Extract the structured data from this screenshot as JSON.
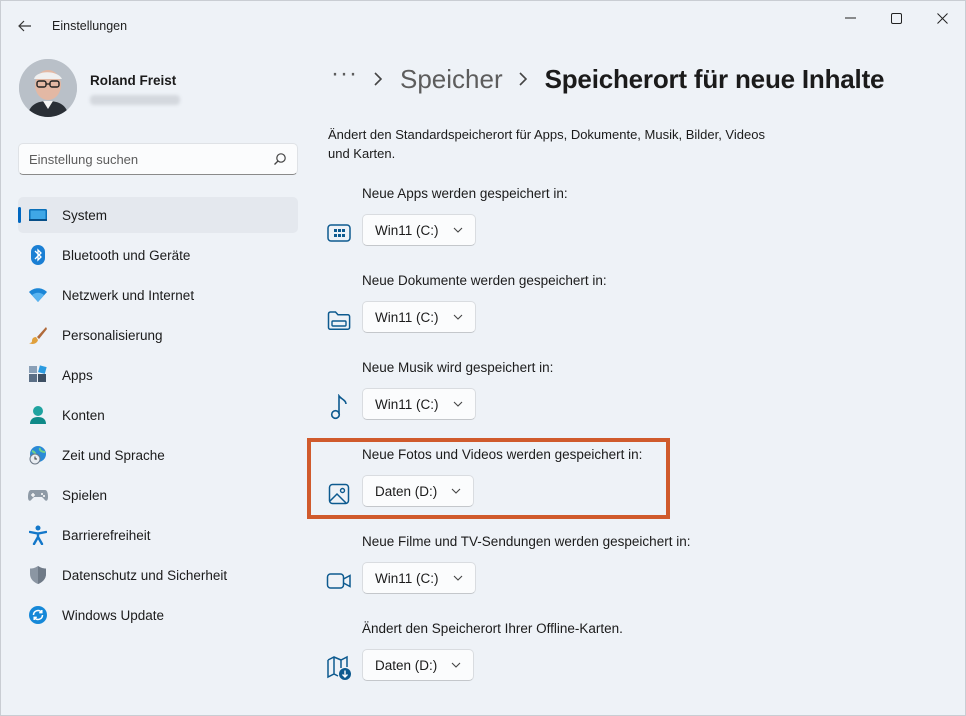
{
  "app": {
    "title": "Einstellungen"
  },
  "user": {
    "name": "Roland Freist"
  },
  "search": {
    "placeholder": "Einstellung suchen"
  },
  "nav": {
    "items": [
      {
        "label": "System",
        "icon": "system-icon",
        "active": true
      },
      {
        "label": "Bluetooth und Geräte",
        "icon": "bluetooth-icon"
      },
      {
        "label": "Netzwerk und Internet",
        "icon": "wifi-icon"
      },
      {
        "label": "Personalisierung",
        "icon": "brush-icon"
      },
      {
        "label": "Apps",
        "icon": "apps-icon"
      },
      {
        "label": "Konten",
        "icon": "person-icon"
      },
      {
        "label": "Zeit und Sprache",
        "icon": "globe-clock-icon"
      },
      {
        "label": "Spielen",
        "icon": "gamepad-icon"
      },
      {
        "label": "Barrierefreiheit",
        "icon": "accessibility-icon"
      },
      {
        "label": "Datenschutz und Sicherheit",
        "icon": "shield-icon"
      },
      {
        "label": "Windows Update",
        "icon": "sync-icon"
      }
    ]
  },
  "breadcrumb": {
    "more": "···",
    "parent": "Speicher",
    "current": "Speicherort für neue Inhalte"
  },
  "description": "Ändert den Standardspeicherort für Apps, Dokumente, Musik, Bilder, Videos und Karten.",
  "settings": [
    {
      "label": "Neue Apps werden gespeichert in:",
      "value": "Win11 (C:)",
      "icon": "apps-drive-icon"
    },
    {
      "label": "Neue Dokumente werden gespeichert in:",
      "value": "Win11 (C:)",
      "icon": "folder-icon"
    },
    {
      "label": "Neue Musik wird gespeichert in:",
      "value": "Win11 (C:)",
      "icon": "music-note-icon"
    },
    {
      "label": "Neue Fotos und Videos werden gespeichert in:",
      "value": "Daten (D:)",
      "icon": "image-icon"
    },
    {
      "label": "Neue Filme und TV-Sendungen werden gespeichert in:",
      "value": "Win11 (C:)",
      "icon": "video-camera-icon"
    },
    {
      "label": "Ändert den Speicherort Ihrer Offline-Karten.",
      "value": "Daten (D:)",
      "icon": "map-download-icon"
    }
  ],
  "colors": {
    "accent": "#0067c0",
    "highlight": "#d05a2c",
    "background": "#eef2f7"
  }
}
